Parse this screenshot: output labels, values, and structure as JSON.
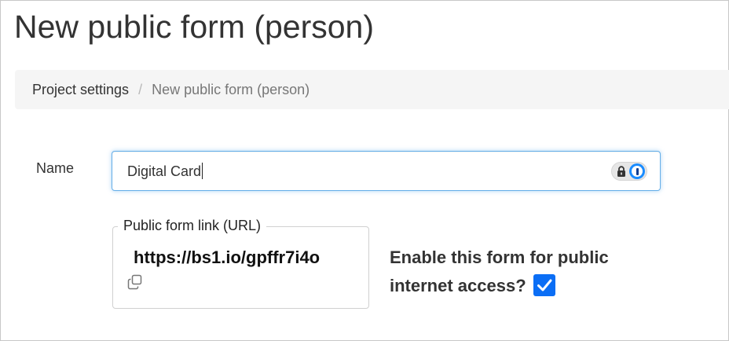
{
  "page": {
    "title": "New public form (person)"
  },
  "breadcrumb": {
    "items": [
      {
        "label": "Project settings"
      },
      {
        "label": "New public form (person)"
      }
    ],
    "separator": "/"
  },
  "form": {
    "name": {
      "label": "Name",
      "value": "Digital Card"
    },
    "public_link": {
      "legend": "Public form link (URL)",
      "url": "https://bs1.io/gpffr7i4o",
      "copy_icon": "copy-icon"
    },
    "enable_public_access": {
      "label": "Enable this form for public internet access?",
      "checked": true
    }
  },
  "icons": {
    "password_manager": [
      "lock-icon",
      "onepassword-icon"
    ]
  },
  "colors": {
    "focus_border": "#66afe9",
    "checkbox_accent": "#0b6ef5",
    "breadcrumb_bg": "#f5f5f5"
  }
}
